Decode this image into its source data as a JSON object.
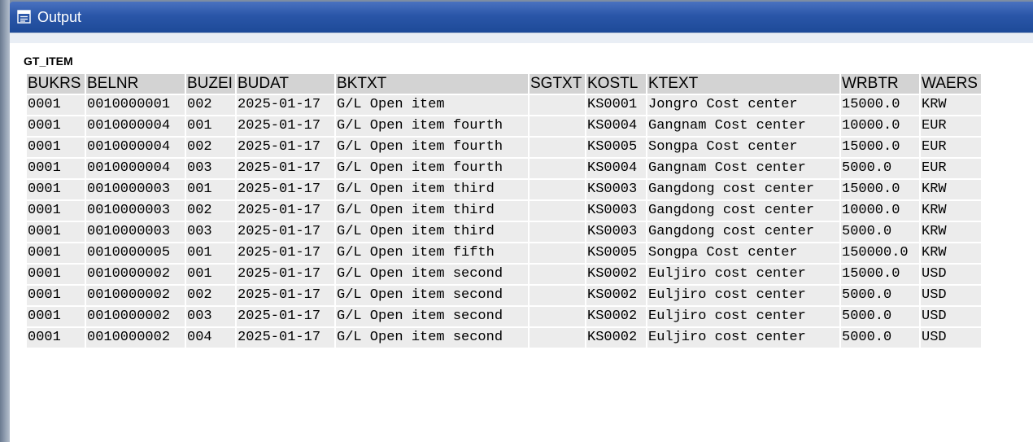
{
  "window": {
    "title": "Output",
    "title_icon": "list-output-icon"
  },
  "list": {
    "title": "GT_ITEM",
    "columns": [
      "BUKRS",
      "BELNR",
      "BUZEI",
      "BUDAT",
      "BKTXT",
      "SGTXT",
      "KOSTL",
      "KTEXT",
      "WRBTR",
      "WAERS"
    ],
    "rows": [
      [
        "0001",
        "0010000001",
        "002",
        "2025-01-17",
        "G/L Open item",
        "",
        "KS0001",
        "Jongro Cost center",
        "15000.0",
        "KRW"
      ],
      [
        "0001",
        "0010000004",
        "001",
        "2025-01-17",
        "G/L Open item fourth",
        "",
        "KS0004",
        "Gangnam Cost center",
        "10000.0",
        "EUR"
      ],
      [
        "0001",
        "0010000004",
        "002",
        "2025-01-17",
        "G/L Open item fourth",
        "",
        "KS0005",
        "Songpa Cost center",
        "15000.0",
        "EUR"
      ],
      [
        "0001",
        "0010000004",
        "003",
        "2025-01-17",
        "G/L Open item fourth",
        "",
        "KS0004",
        "Gangnam Cost center",
        "5000.0",
        "EUR"
      ],
      [
        "0001",
        "0010000003",
        "001",
        "2025-01-17",
        "G/L Open item third",
        "",
        "KS0003",
        "Gangdong cost center",
        "15000.0",
        "KRW"
      ],
      [
        "0001",
        "0010000003",
        "002",
        "2025-01-17",
        "G/L Open item third",
        "",
        "KS0003",
        "Gangdong cost center",
        "10000.0",
        "KRW"
      ],
      [
        "0001",
        "0010000003",
        "003",
        "2025-01-17",
        "G/L Open item third",
        "",
        "KS0003",
        "Gangdong cost center",
        "5000.0",
        "KRW"
      ],
      [
        "0001",
        "0010000005",
        "001",
        "2025-01-17",
        "G/L Open item fifth",
        "",
        "KS0005",
        "Songpa Cost center",
        "150000.0",
        "KRW"
      ],
      [
        "0001",
        "0010000002",
        "001",
        "2025-01-17",
        "G/L Open item second",
        "",
        "KS0002",
        "Euljiro cost center",
        "15000.0",
        "USD"
      ],
      [
        "0001",
        "0010000002",
        "002",
        "2025-01-17",
        "G/L Open item second",
        "",
        "KS0002",
        "Euljiro cost center",
        "5000.0",
        "USD"
      ],
      [
        "0001",
        "0010000002",
        "003",
        "2025-01-17",
        "G/L Open item second",
        "",
        "KS0002",
        "Euljiro cost center",
        "5000.0",
        "USD"
      ],
      [
        "0001",
        "0010000002",
        "004",
        "2025-01-17",
        "G/L Open item second",
        "",
        "KS0002",
        "Euljiro cost center",
        "5000.0",
        "USD"
      ]
    ]
  },
  "colors": {
    "title_bar": "#2a56a8",
    "header_cell": "#d3d3d3",
    "data_cell": "#ececec"
  }
}
